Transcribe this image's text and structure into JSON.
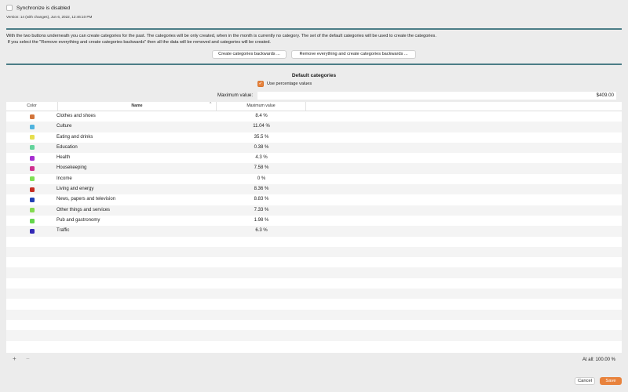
{
  "sync": {
    "label": "Synchronize is disabled",
    "checked": false
  },
  "version": "Version: 14 (with changes), Jun 6, 2022, 12:46:10 PM",
  "info_text": "With the two buttons underneath you can create categories for the past. The categories will be only created, when in the month is currently no category. The set of the default categories will be used to create the categories.\n If you select the \"Remove everything and create categories backwards\" then all the data will be removed and categories will be created.",
  "buttons": {
    "create_backwards": "Create categories backwards ...",
    "remove_and_create": "Remove everything and create categories backwards ..."
  },
  "default_categories": {
    "title": "Default categories",
    "use_percentage_label": "Use percentage values",
    "use_percentage_checked": true,
    "max_value_label": "Maximum value:",
    "max_value": "$409.00"
  },
  "table": {
    "columns": {
      "color": "Color",
      "name": "Name",
      "max_value": "Maximum value"
    },
    "rows": [
      {
        "color": "#d2743a",
        "name": "Clothes and shoes",
        "value": "8.4 %"
      },
      {
        "color": "#4fb3de",
        "name": "Culture",
        "value": "11.04 %"
      },
      {
        "color": "#e6de4e",
        "name": "Eating and drinks",
        "value": "35.5 %"
      },
      {
        "color": "#63d39b",
        "name": "Education",
        "value": "0.38 %"
      },
      {
        "color": "#a62ed0",
        "name": "Health",
        "value": "4.3 %"
      },
      {
        "color": "#cf2f8e",
        "name": "Housekeeping",
        "value": "7.58 %"
      },
      {
        "color": "#7fe055",
        "name": "Income",
        "value": "0 %"
      },
      {
        "color": "#c62d22",
        "name": "Living and energy",
        "value": "8.36 %"
      },
      {
        "color": "#2140b5",
        "name": "News, papers and television",
        "value": "8.83 %"
      },
      {
        "color": "#83da4f",
        "name": "Other things and services",
        "value": "7.33 %"
      },
      {
        "color": "#64d64c",
        "name": "Pub and gastronomy",
        "value": "1.98 %"
      },
      {
        "color": "#3329b6",
        "name": "Traffic",
        "value": "6.3 %"
      }
    ]
  },
  "footer": {
    "add_label": "+",
    "remove_label": "−",
    "total": "At all: 100.00 %"
  },
  "actions": {
    "cancel": "Cancel",
    "save": "Save"
  },
  "colors": {
    "accent": "#e8823c",
    "rule": "#4b7d86"
  }
}
